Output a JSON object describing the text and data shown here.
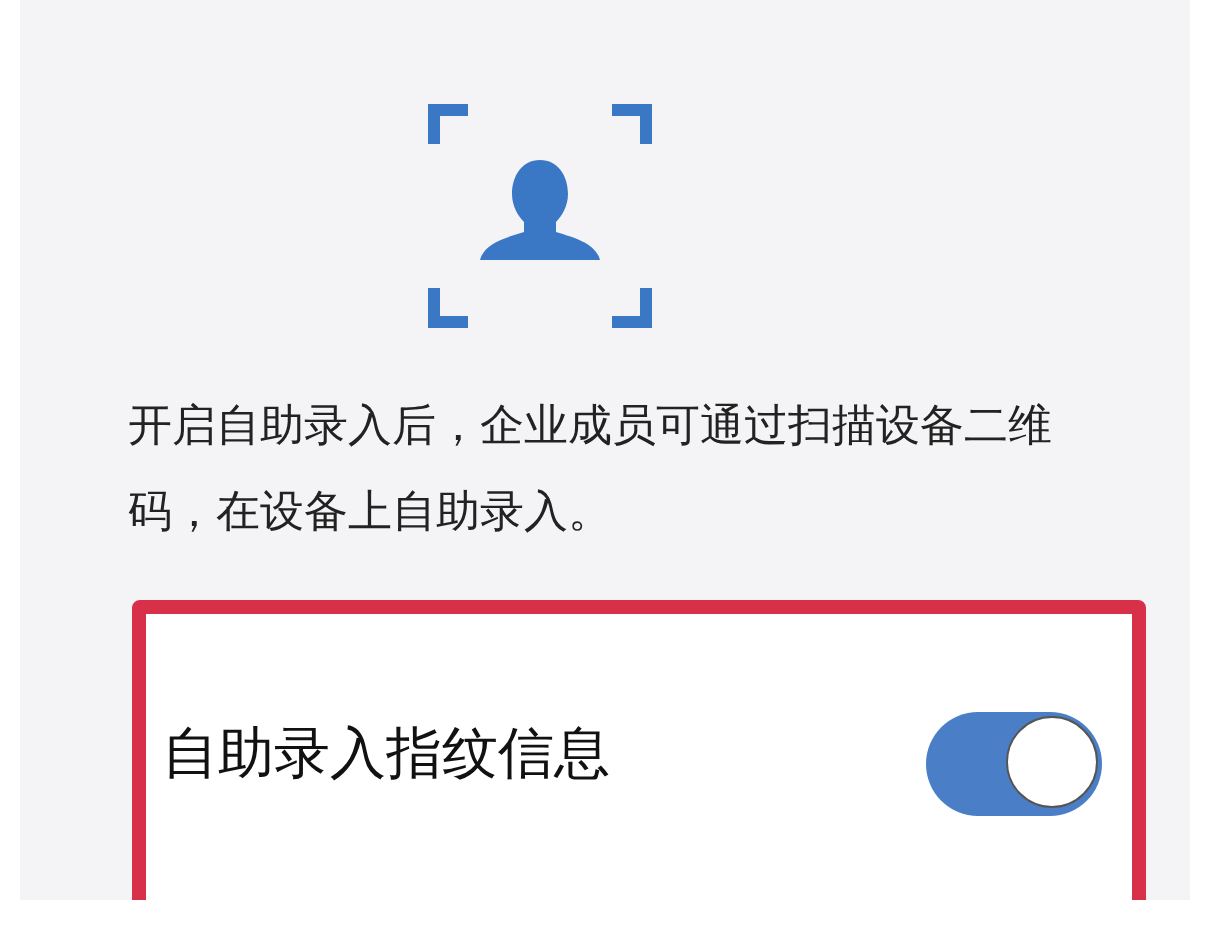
{
  "description": "开启自助录入后，企业成员可通过扫描设备二维码，在设备上自助录入。",
  "setting": {
    "label": "自助录入指纹信息",
    "on": true
  }
}
